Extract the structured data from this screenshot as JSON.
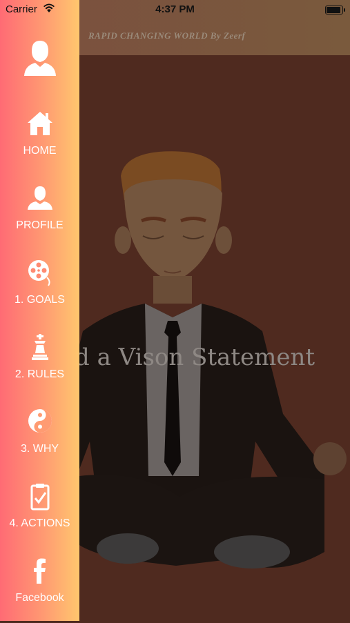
{
  "status_bar": {
    "carrier": "Carrier",
    "time": "4:37 PM"
  },
  "header": {
    "title": "RAPID CHANGING WORLD By Zeerf"
  },
  "main": {
    "headline": "d a Vison Statement"
  },
  "drawer": {
    "items": [
      {
        "label": "HOME",
        "icon": "home-icon"
      },
      {
        "label": "PROFILE",
        "icon": "person-icon"
      },
      {
        "label": "1. GOALS",
        "icon": "film-reel-icon"
      },
      {
        "label": "2. RULES",
        "icon": "chess-icon"
      },
      {
        "label": "3. WHY",
        "icon": "yin-yang-icon"
      },
      {
        "label": "4. ACTIONS",
        "icon": "clipboard-check-icon"
      },
      {
        "label": "Facebook",
        "icon": "facebook-icon"
      }
    ]
  },
  "colors": {
    "drawer_start": "#ff6b74",
    "drawer_end": "#ffc76e",
    "background": "#4f2a1f"
  }
}
